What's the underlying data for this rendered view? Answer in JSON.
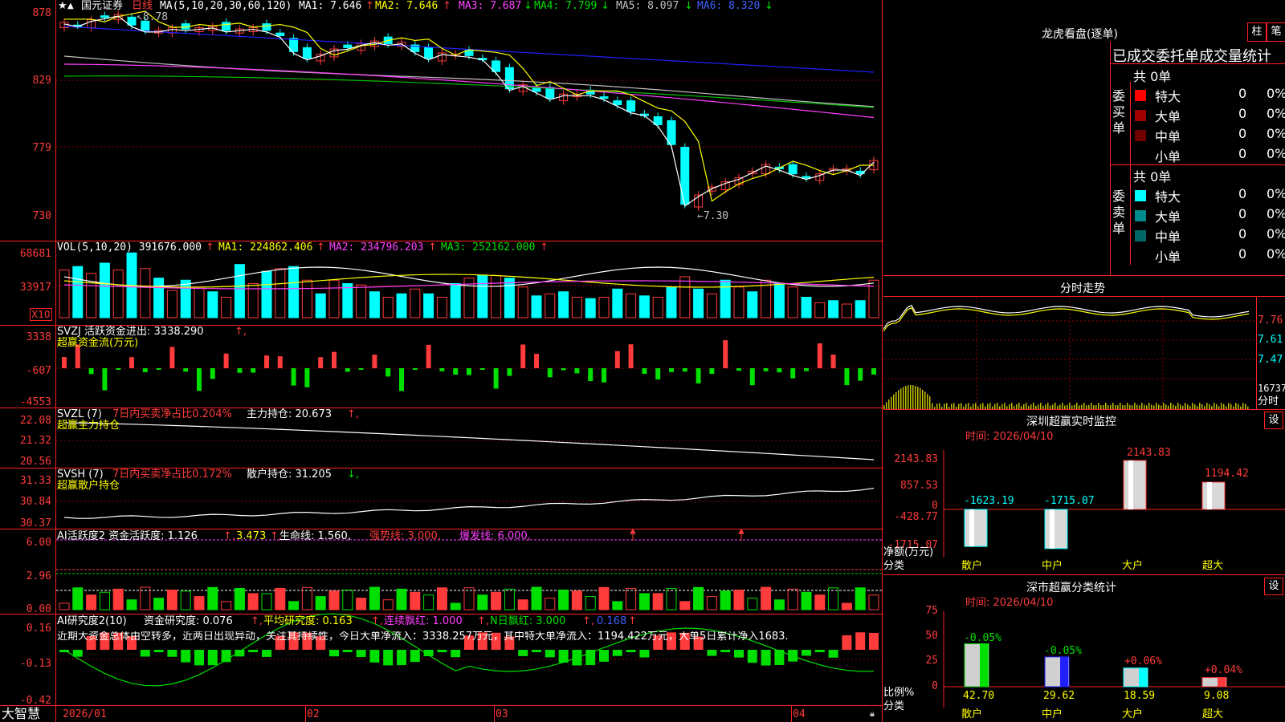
{
  "main": {
    "title": "国元证券",
    "period": "日线",
    "high_mark": "8.78",
    "low_mark": "7.30",
    "ma_label": "MA(5,10,20,30,60,120)",
    "ma1": "MA1: 7.646",
    "ma2": "MA2: 7.646",
    "ma3": "MA3: 7.687",
    "ma4": "MA4: 7.799",
    "ma5": "MA5: 8.097",
    "ma6": "MA6: 8.320",
    "y_labels": [
      "878",
      "829",
      "779",
      "730"
    ]
  },
  "vol": {
    "label": "VOL(5,10,20) 391676.000",
    "ma1": "MA1: 224862.406",
    "ma2": "MA2: 234796.203",
    "ma3": "MA3: 252162.000",
    "y_labels": [
      "68681",
      "33917"
    ],
    "unit": "X10"
  },
  "svzj": {
    "label": "SVZJ  活跃资金进出: 3338.290",
    "sub": "超赢资金流(万元)",
    "y_labels": [
      "3338",
      "-607",
      "-4553"
    ]
  },
  "svzl": {
    "label": "SVZL  (7)",
    "ratio": "7日内买卖净占比0.204%",
    "hold": "主力持仓: 20.673",
    "sub": "超赢主力持仓",
    "y_labels": [
      "22.08",
      "21.32",
      "20.56"
    ]
  },
  "svsh": {
    "label": "SVSH  (7)",
    "ratio": "7日内买卖净占比0.172%",
    "hold": "散户持仓: 31.205",
    "sub": "超赢散户持仓",
    "y_labels": [
      "31.33",
      "30.84",
      "30.37"
    ]
  },
  "ai1": {
    "label": "AI活跃度2 资金活跃度: 1.126",
    "v2": "3.473",
    "life": "生命线: 1.560,",
    "strong": "强势线: 3.000,",
    "burst": "爆发线: 6.000,",
    "y_labels": [
      "6.00",
      "2.96",
      "0.00"
    ]
  },
  "ai2": {
    "label": "AI研究度2(10)",
    "research": "资金研究度: 0.076",
    "avg": "平均研究度: 0.163",
    "cont": "连续飘红: 1.000",
    "nday": "N日飘红: 3.000",
    "last": "0.168",
    "comment": "近期大资金总体由空转多，近两日出现异动，关注其持续性，今日大单净流入：3338.257万元，其中特大单净流入：1194.422万元，大单5日累计净入1683.",
    "y_labels": [
      "0.16",
      "-0.13",
      "-0.42"
    ]
  },
  "bottom": {
    "logo": "大智慧",
    "dates": [
      "2026/01",
      "02",
      "03",
      "04"
    ]
  },
  "right": {
    "lhb_title": "龙虎看盘(逐单)",
    "btn_zhu": "柱",
    "btn_bi": "笔",
    "panel_title": "已成交委托单成交量统计",
    "buy_total": "共 0单",
    "buy_side": "委买单",
    "sell_total": "共 0单",
    "sell_side": "委卖单",
    "buy_rows": [
      {
        "name": "特大",
        "count": "0",
        "pct": "0%",
        "color": "#ff0000"
      },
      {
        "name": "大单",
        "count": "0",
        "pct": "0%",
        "color": "#a00000"
      },
      {
        "name": "中单",
        "count": "0",
        "pct": "0%",
        "color": "#700000"
      },
      {
        "name": "小单",
        "count": "0",
        "pct": "0%",
        "color": ""
      }
    ],
    "sell_rows": [
      {
        "name": "特大",
        "count": "0",
        "pct": "0%",
        "color": "#00ffff"
      },
      {
        "name": "大单",
        "count": "0",
        "pct": "0%",
        "color": "#008c8c"
      },
      {
        "name": "中单",
        "count": "0",
        "pct": "0%",
        "color": "#006868"
      },
      {
        "name": "小单",
        "count": "0",
        "pct": "0%",
        "color": ""
      }
    ],
    "fenshi": {
      "title": "分时走势",
      "p1": "7.76",
      "p2": "7.61",
      "p3": "7.47",
      "vol": "16737",
      "unit": "分时"
    },
    "monitor": {
      "title": "深圳超赢实时监控",
      "btn": "设",
      "time": "时间: 2026/04/10",
      "y": [
        "2143.83",
        "857.53",
        "0",
        "-428.77",
        "-1715.07"
      ],
      "ylabel": "净额(万元)",
      "xlabel": "分类",
      "cats": [
        "散户",
        "中户",
        "大户",
        "超大"
      ],
      "values": [
        "-1623.19",
        "-1715.07",
        "2143.83",
        "1194.42"
      ]
    },
    "classify": {
      "title": "深市超赢分类统计",
      "btn": "设",
      "time": "时间: 2026/04/10",
      "y": [
        "75",
        "50",
        "25",
        "0"
      ],
      "ylabel": "比例%",
      "xlabel": "分类",
      "cats": [
        "散户",
        "中户",
        "大户",
        "超大"
      ],
      "deltas": [
        "-0.05%",
        "-0.05%",
        "+0.06%",
        "+0.04%"
      ],
      "values": [
        "42.70",
        "29.62",
        "18.59",
        "9.08"
      ]
    }
  },
  "colors": {
    "up": "#ff3b3b",
    "down": "#00ffff",
    "grid": "#8b0000",
    "frame": "#ff2020"
  }
}
